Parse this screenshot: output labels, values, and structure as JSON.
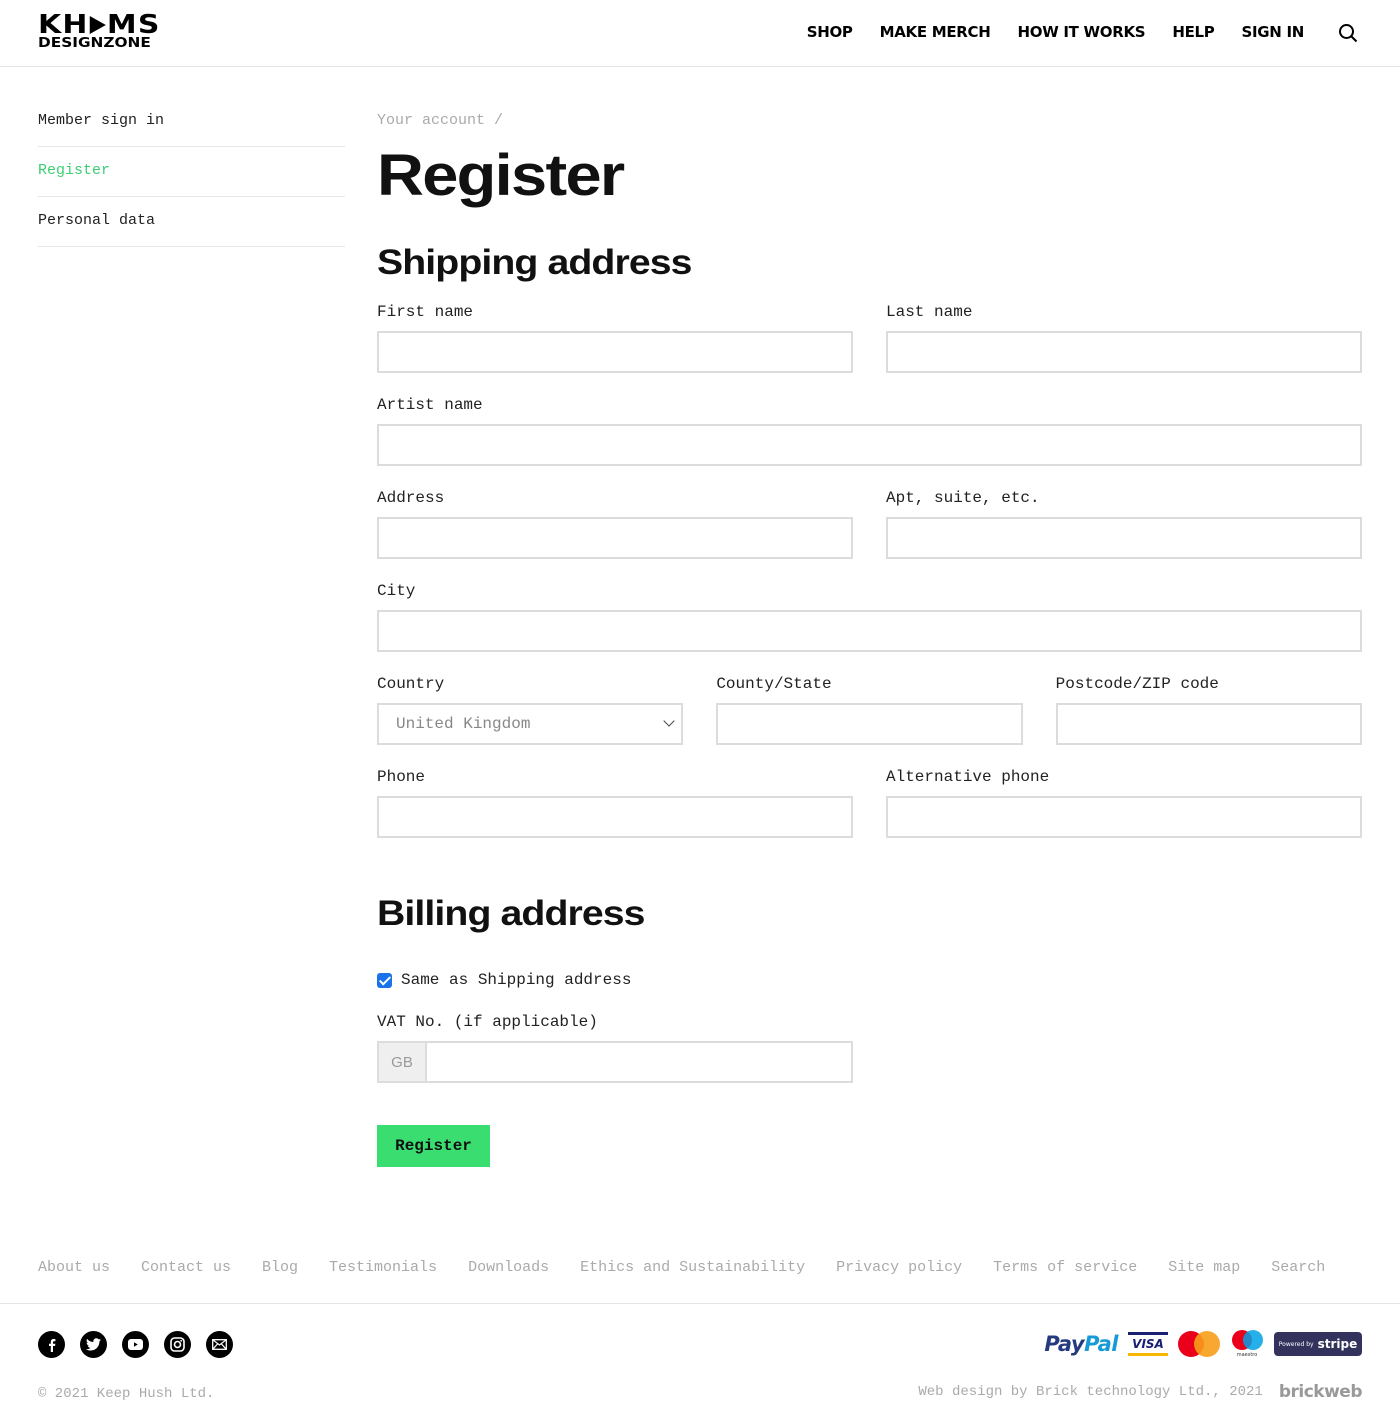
{
  "brand": {
    "logo_line1_a": "KH",
    "logo_line1_b": "MS",
    "logo_line2": "DESIGNZONE"
  },
  "nav": {
    "items": [
      {
        "label": "SHOP"
      },
      {
        "label": "MAKE MERCH"
      },
      {
        "label": "HOW IT WORKS"
      },
      {
        "label": "HELP"
      },
      {
        "label": "SIGN IN"
      }
    ],
    "search_icon": "search-icon"
  },
  "sidebar": {
    "items": [
      {
        "label": "Member sign in",
        "active": false
      },
      {
        "label": "Register",
        "active": true
      },
      {
        "label": "Personal data",
        "active": false
      }
    ]
  },
  "breadcrumb": "Your account /",
  "page_title": "Register",
  "shipping": {
    "title": "Shipping address",
    "fields": {
      "first_name": {
        "label": "First name",
        "value": ""
      },
      "last_name": {
        "label": "Last name",
        "value": ""
      },
      "artist_name": {
        "label": "Artist name",
        "value": ""
      },
      "address": {
        "label": "Address",
        "value": ""
      },
      "apt": {
        "label": "Apt, suite, etc.",
        "value": ""
      },
      "city": {
        "label": "City",
        "value": ""
      },
      "country": {
        "label": "Country",
        "value": "United Kingdom"
      },
      "county": {
        "label": "County/State",
        "value": ""
      },
      "postcode": {
        "label": "Postcode/ZIP code",
        "value": ""
      },
      "phone": {
        "label": "Phone",
        "value": ""
      },
      "alt_phone": {
        "label": "Alternative phone",
        "value": ""
      }
    }
  },
  "billing": {
    "title": "Billing address",
    "same_as_shipping": {
      "label": "Same as Shipping address",
      "checked": true
    },
    "vat": {
      "label": "VAT No. (if applicable)",
      "prefix": "GB",
      "value": ""
    },
    "submit_label": "Register"
  },
  "footer": {
    "links": [
      "About us",
      "Contact us",
      "Blog",
      "Testimonials",
      "Downloads",
      "Ethics and Sustainability",
      "Privacy policy",
      "Terms of service",
      "Site map",
      "Search"
    ],
    "socials": [
      "facebook-icon",
      "twitter-icon",
      "youtube-icon",
      "instagram-icon",
      "email-icon"
    ],
    "copyright": "© 2021 Keep Hush Ltd.",
    "payments": {
      "paypal_a": "Pay",
      "paypal_b": "Pal",
      "visa": "VISA",
      "maestro": "maestro",
      "stripe_powered": "Powered by",
      "stripe": "stripe"
    },
    "credit": "Web design by Brick technology Ltd., 2021",
    "credit_brand": "brickweb"
  },
  "colors": {
    "accent_green": "#3ade70",
    "active_link": "#3ecf73",
    "checkbox_blue": "#1a73e8"
  }
}
